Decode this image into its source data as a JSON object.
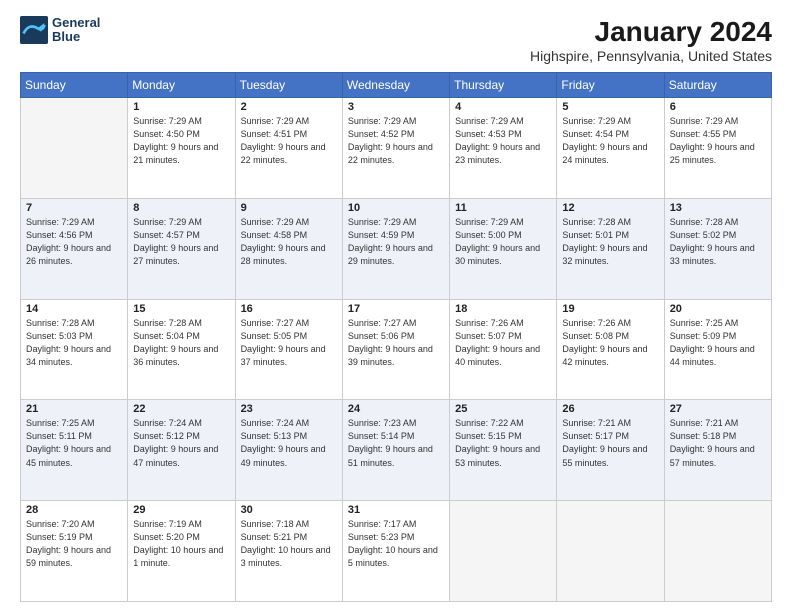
{
  "header": {
    "logo_line1": "General",
    "logo_line2": "Blue",
    "title": "January 2024",
    "subtitle": "Highspire, Pennsylvania, United States"
  },
  "weekdays": [
    "Sunday",
    "Monday",
    "Tuesday",
    "Wednesday",
    "Thursday",
    "Friday",
    "Saturday"
  ],
  "weeks": [
    [
      {
        "day": "",
        "sunrise": "",
        "sunset": "",
        "daylight": ""
      },
      {
        "day": "1",
        "sunrise": "Sunrise: 7:29 AM",
        "sunset": "Sunset: 4:50 PM",
        "daylight": "Daylight: 9 hours and 21 minutes."
      },
      {
        "day": "2",
        "sunrise": "Sunrise: 7:29 AM",
        "sunset": "Sunset: 4:51 PM",
        "daylight": "Daylight: 9 hours and 22 minutes."
      },
      {
        "day": "3",
        "sunrise": "Sunrise: 7:29 AM",
        "sunset": "Sunset: 4:52 PM",
        "daylight": "Daylight: 9 hours and 22 minutes."
      },
      {
        "day": "4",
        "sunrise": "Sunrise: 7:29 AM",
        "sunset": "Sunset: 4:53 PM",
        "daylight": "Daylight: 9 hours and 23 minutes."
      },
      {
        "day": "5",
        "sunrise": "Sunrise: 7:29 AM",
        "sunset": "Sunset: 4:54 PM",
        "daylight": "Daylight: 9 hours and 24 minutes."
      },
      {
        "day": "6",
        "sunrise": "Sunrise: 7:29 AM",
        "sunset": "Sunset: 4:55 PM",
        "daylight": "Daylight: 9 hours and 25 minutes."
      }
    ],
    [
      {
        "day": "7",
        "sunrise": "Sunrise: 7:29 AM",
        "sunset": "Sunset: 4:56 PM",
        "daylight": "Daylight: 9 hours and 26 minutes."
      },
      {
        "day": "8",
        "sunrise": "Sunrise: 7:29 AM",
        "sunset": "Sunset: 4:57 PM",
        "daylight": "Daylight: 9 hours and 27 minutes."
      },
      {
        "day": "9",
        "sunrise": "Sunrise: 7:29 AM",
        "sunset": "Sunset: 4:58 PM",
        "daylight": "Daylight: 9 hours and 28 minutes."
      },
      {
        "day": "10",
        "sunrise": "Sunrise: 7:29 AM",
        "sunset": "Sunset: 4:59 PM",
        "daylight": "Daylight: 9 hours and 29 minutes."
      },
      {
        "day": "11",
        "sunrise": "Sunrise: 7:29 AM",
        "sunset": "Sunset: 5:00 PM",
        "daylight": "Daylight: 9 hours and 30 minutes."
      },
      {
        "day": "12",
        "sunrise": "Sunrise: 7:28 AM",
        "sunset": "Sunset: 5:01 PM",
        "daylight": "Daylight: 9 hours and 32 minutes."
      },
      {
        "day": "13",
        "sunrise": "Sunrise: 7:28 AM",
        "sunset": "Sunset: 5:02 PM",
        "daylight": "Daylight: 9 hours and 33 minutes."
      }
    ],
    [
      {
        "day": "14",
        "sunrise": "Sunrise: 7:28 AM",
        "sunset": "Sunset: 5:03 PM",
        "daylight": "Daylight: 9 hours and 34 minutes."
      },
      {
        "day": "15",
        "sunrise": "Sunrise: 7:28 AM",
        "sunset": "Sunset: 5:04 PM",
        "daylight": "Daylight: 9 hours and 36 minutes."
      },
      {
        "day": "16",
        "sunrise": "Sunrise: 7:27 AM",
        "sunset": "Sunset: 5:05 PM",
        "daylight": "Daylight: 9 hours and 37 minutes."
      },
      {
        "day": "17",
        "sunrise": "Sunrise: 7:27 AM",
        "sunset": "Sunset: 5:06 PM",
        "daylight": "Daylight: 9 hours and 39 minutes."
      },
      {
        "day": "18",
        "sunrise": "Sunrise: 7:26 AM",
        "sunset": "Sunset: 5:07 PM",
        "daylight": "Daylight: 9 hours and 40 minutes."
      },
      {
        "day": "19",
        "sunrise": "Sunrise: 7:26 AM",
        "sunset": "Sunset: 5:08 PM",
        "daylight": "Daylight: 9 hours and 42 minutes."
      },
      {
        "day": "20",
        "sunrise": "Sunrise: 7:25 AM",
        "sunset": "Sunset: 5:09 PM",
        "daylight": "Daylight: 9 hours and 44 minutes."
      }
    ],
    [
      {
        "day": "21",
        "sunrise": "Sunrise: 7:25 AM",
        "sunset": "Sunset: 5:11 PM",
        "daylight": "Daylight: 9 hours and 45 minutes."
      },
      {
        "day": "22",
        "sunrise": "Sunrise: 7:24 AM",
        "sunset": "Sunset: 5:12 PM",
        "daylight": "Daylight: 9 hours and 47 minutes."
      },
      {
        "day": "23",
        "sunrise": "Sunrise: 7:24 AM",
        "sunset": "Sunset: 5:13 PM",
        "daylight": "Daylight: 9 hours and 49 minutes."
      },
      {
        "day": "24",
        "sunrise": "Sunrise: 7:23 AM",
        "sunset": "Sunset: 5:14 PM",
        "daylight": "Daylight: 9 hours and 51 minutes."
      },
      {
        "day": "25",
        "sunrise": "Sunrise: 7:22 AM",
        "sunset": "Sunset: 5:15 PM",
        "daylight": "Daylight: 9 hours and 53 minutes."
      },
      {
        "day": "26",
        "sunrise": "Sunrise: 7:21 AM",
        "sunset": "Sunset: 5:17 PM",
        "daylight": "Daylight: 9 hours and 55 minutes."
      },
      {
        "day": "27",
        "sunrise": "Sunrise: 7:21 AM",
        "sunset": "Sunset: 5:18 PM",
        "daylight": "Daylight: 9 hours and 57 minutes."
      }
    ],
    [
      {
        "day": "28",
        "sunrise": "Sunrise: 7:20 AM",
        "sunset": "Sunset: 5:19 PM",
        "daylight": "Daylight: 9 hours and 59 minutes."
      },
      {
        "day": "29",
        "sunrise": "Sunrise: 7:19 AM",
        "sunset": "Sunset: 5:20 PM",
        "daylight": "Daylight: 10 hours and 1 minute."
      },
      {
        "day": "30",
        "sunrise": "Sunrise: 7:18 AM",
        "sunset": "Sunset: 5:21 PM",
        "daylight": "Daylight: 10 hours and 3 minutes."
      },
      {
        "day": "31",
        "sunrise": "Sunrise: 7:17 AM",
        "sunset": "Sunset: 5:23 PM",
        "daylight": "Daylight: 10 hours and 5 minutes."
      },
      {
        "day": "",
        "sunrise": "",
        "sunset": "",
        "daylight": ""
      },
      {
        "day": "",
        "sunrise": "",
        "sunset": "",
        "daylight": ""
      },
      {
        "day": "",
        "sunrise": "",
        "sunset": "",
        "daylight": ""
      }
    ]
  ]
}
